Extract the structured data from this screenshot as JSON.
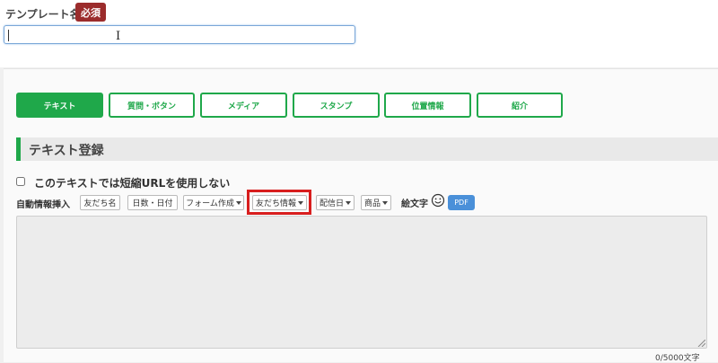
{
  "template_name": {
    "label": "テンプレート名",
    "required_badge": "必須",
    "value": ""
  },
  "tabs": [
    {
      "label": "テキスト",
      "active": true
    },
    {
      "label": "質問・ボタン",
      "active": false
    },
    {
      "label": "メディア",
      "active": false
    },
    {
      "label": "スタンプ",
      "active": false
    },
    {
      "label": "位置情報",
      "active": false
    },
    {
      "label": "紹介",
      "active": false
    }
  ],
  "section": {
    "title": "テキスト登録"
  },
  "short_url_checkbox": {
    "label": "このテキストでは短縮URLを使用しない",
    "checked": false
  },
  "auto_insert": {
    "label": "自動情報挿入",
    "buttons": [
      {
        "label": "友だち名",
        "dropdown": false
      },
      {
        "label": "日数・日付",
        "dropdown": false
      },
      {
        "label": "フォーム作成",
        "dropdown": true
      },
      {
        "label": "友だち情報",
        "dropdown": true,
        "highlighted": true
      },
      {
        "label": "配信日",
        "dropdown": true
      },
      {
        "label": "商品",
        "dropdown": true
      }
    ],
    "emoji_label": "絵文字",
    "pdf_label": "PDF"
  },
  "message": {
    "value": ""
  },
  "char_counter": "0/5000文字",
  "colors": {
    "accent_green": "#1fa84a",
    "required_red": "#9b2c2c",
    "highlight_red": "#d81e1e",
    "pdf_blue": "#4a90d9"
  },
  "icons": [
    "smiley-icon",
    "resize-handle-icon",
    "text-cursor-icon"
  ]
}
